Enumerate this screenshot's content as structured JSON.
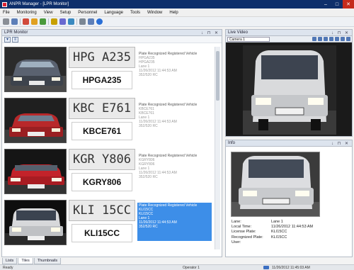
{
  "window": {
    "title": "ANPR Manager - [LPR Monitor]",
    "controls": [
      "–",
      "□",
      "✕"
    ]
  },
  "menu": [
    "File",
    "Monitoring",
    "View",
    "Setup",
    "Personnel",
    "Language",
    "Tools",
    "Window",
    "Help"
  ],
  "toolbar_icon_colors": [
    "#8a8f96",
    "#5d7fb8",
    "#d14a3b",
    "#e0a020",
    "#4b9a3c",
    "#c8a000",
    "#6a6ad0",
    "#3a8ac0",
    "#7b8794",
    "#5d7fb8",
    "#2a6fd6"
  ],
  "lpr_monitor": {
    "tab_title": "LPR Monitor",
    "tab_controls": "↓ ⊓ ✕",
    "tool_icons": [
      "filter-icon",
      "list-icon"
    ],
    "records": [
      {
        "plate_image_text": "HPG A235",
        "plate": "HPGA235",
        "status": "Plate Recognized Registered Vehicle",
        "lines": [
          "HPGA235",
          "HPGA235",
          "Lane 1",
          "11/26/2012 11:44:53 AM",
          "352/520 RC"
        ],
        "selected": false
      },
      {
        "plate_image_text": "KBC E761",
        "plate": "KBCE761",
        "status": "Plate Recognized Registered Vehicle",
        "lines": [
          "KBCE761",
          "KBCE761",
          "Lane 1",
          "11/26/2012 11:44:53 AM",
          "352/520 RC"
        ],
        "selected": false
      },
      {
        "plate_image_text": "KGR Y806",
        "plate": "KGRY806",
        "status": "Plate Recognized Registered Vehicle",
        "lines": [
          "KGRY806",
          "KGRY806",
          "Lane 1",
          "11/26/2012 11:44:53 AM",
          "352/520 RC"
        ],
        "selected": false
      },
      {
        "plate_image_text": "KLI 15CC",
        "plate": "KLI15CC",
        "status": "Plate Recognized Registered Vehicle",
        "lines": [
          "KLI15CC",
          "KLI15CC",
          "Lane 1",
          "11/26/2012 11:44:53 AM",
          "352/520 RC"
        ],
        "selected": true
      }
    ],
    "bottom_tabs": [
      "Lists",
      "Tiles",
      "Thumbnails"
    ],
    "active_tab": "Tiles"
  },
  "live_video": {
    "title": "Live Video",
    "controls": "↓ ⊓ ✕",
    "camera": "Camera 1"
  },
  "info": {
    "title": "Info",
    "controls": "↓ ⊓ ✕",
    "fields": [
      {
        "label": "Lane:",
        "value": "Lane 1"
      },
      {
        "label": "Local Time:",
        "value": "11/26/2012 11:44:53 AM"
      },
      {
        "label": "License Plate:",
        "value": "KLI15CC"
      },
      {
        "label": "Recognized Plate:",
        "value": "KLI15CC"
      },
      {
        "label": "User:",
        "value": ""
      }
    ]
  },
  "status": {
    "left": "Ready",
    "operator": "Operator 1",
    "datetime": "11/26/2012 11:45:03 AM"
  }
}
